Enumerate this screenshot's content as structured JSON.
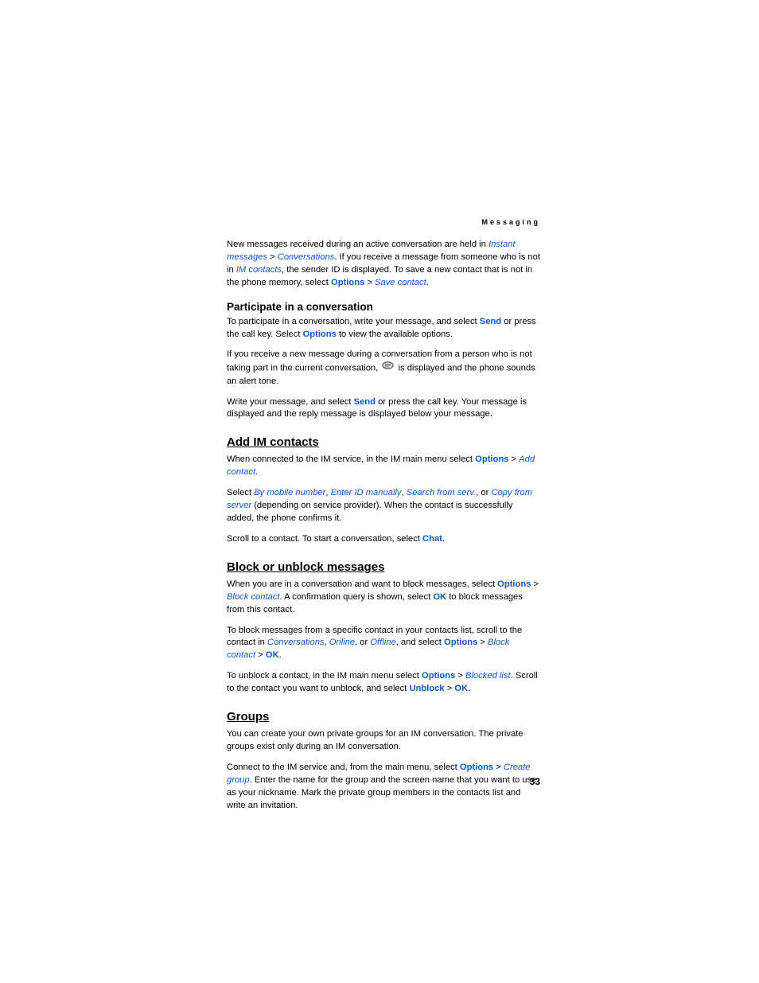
{
  "header": "Messaging",
  "page_number": "33",
  "p1": {
    "t0": "New messages received during an active conversation are held in ",
    "l1": "Instant messages",
    "t1": " > ",
    "l2": "Conversations",
    "t2": ". If you receive a message from someone who is not in ",
    "l3": "IM contacts",
    "t3": ", the sender ID is displayed. To save a new contact that is not in the phone memory, select ",
    "l4": "Options",
    "t4": " > ",
    "l5": "Save contact",
    "t5": "."
  },
  "h_participate": "Participate in a conversation",
  "p2": {
    "t0": "To participate in a conversation, write your message, and select ",
    "l1": "Send",
    "t1": " or press the call key. Select ",
    "l2": "Options",
    "t2": " to view the available options."
  },
  "p3": {
    "t0": "If you receive a new message during a conversation from a person who is not taking part in the current conversation, ",
    "t1": " is displayed and the phone sounds an alert tone."
  },
  "p4": {
    "t0": "Write your message, and select ",
    "l1": "Send",
    "t1": " or press the call key. Your message is displayed and the reply message is displayed below your message."
  },
  "h_add": "Add IM contacts",
  "p5": {
    "t0": "When connected to the IM service, in the IM main menu select ",
    "l1": "Options",
    "t1": " > ",
    "l2": "Add contact",
    "t2": "."
  },
  "p6": {
    "t0": "Select ",
    "l1": "By mobile number",
    "t1": ", ",
    "l2": "Enter ID manually",
    "t2": ", ",
    "l3": "Search from serv.",
    "t3": ", or ",
    "l4": "Copy from server",
    "t4": " (depending on service provider). When the contact is successfully added, the phone confirms it."
  },
  "p7": {
    "t0": "Scroll to a contact. To start a conversation, select ",
    "l1": "Chat",
    "t1": "."
  },
  "h_block": "Block or unblock messages",
  "p8": {
    "t0": "When you are in a conversation and want to block messages, select ",
    "l1": "Options",
    "t1": " > ",
    "l2": "Block contact",
    "t2": ". A confirmation query is shown, select ",
    "l3": "OK",
    "t3": " to block messages from this contact."
  },
  "p9": {
    "t0": "To block messages from a specific contact in your contacts list, scroll to the contact in ",
    "l1": "Conversations",
    "t1": ", ",
    "l2": "Online",
    "t2": ", or ",
    "l3": "Offline",
    "t3": ", and select ",
    "l4": "Options",
    "t4": " > ",
    "l5": "Block contact",
    "t5": " > ",
    "l6": "OK",
    "t6": "."
  },
  "p10": {
    "t0": "To unblock a contact, in the IM main menu select ",
    "l1": "Options",
    "t1": " > ",
    "l2": "Blocked list",
    "t2": ". Scroll to the contact you want to unblock, and select ",
    "l3": "Unblock",
    "t3": " > ",
    "l4": "OK",
    "t4": "."
  },
  "h_groups": "Groups",
  "p11": {
    "t0": "You can create your own private groups for an IM conversation. The private groups exist only during an IM conversation."
  },
  "p12": {
    "t0": "Connect to the IM service and, from the main menu, select ",
    "l1": "Options",
    "t1": " > ",
    "l2": "Create group",
    "t2": ". Enter the name for the group and the screen name that you want to use as your nickname. Mark the private group members in the contacts list and write an invitation."
  }
}
